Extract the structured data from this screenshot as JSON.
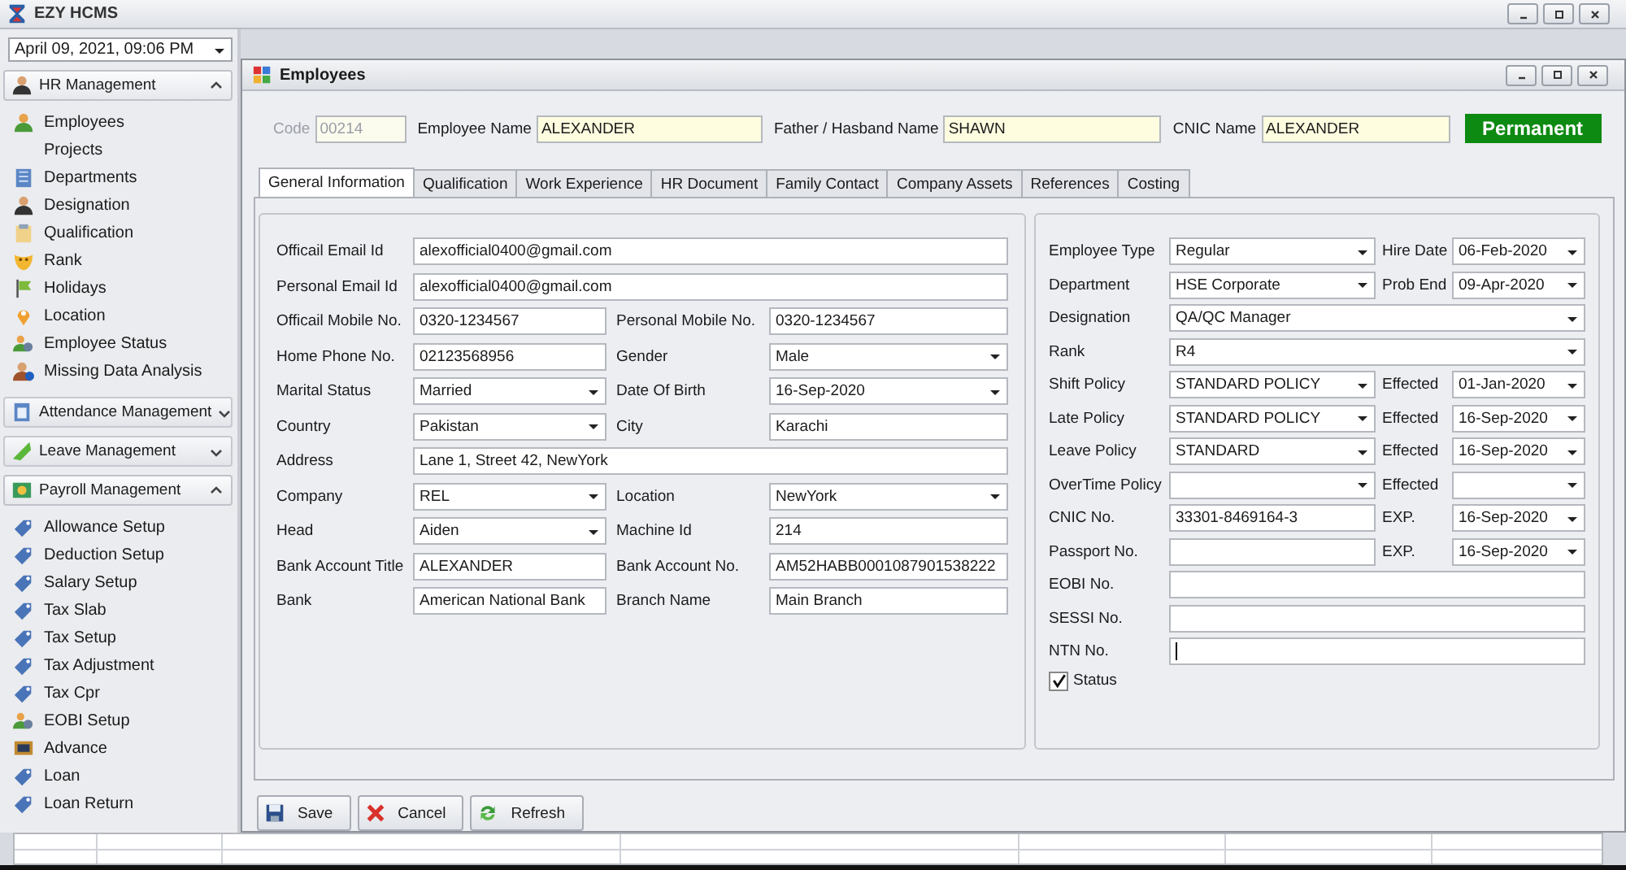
{
  "app": {
    "title": "EZY HCMS"
  },
  "sidebar": {
    "datetime": "April 09, 2021, 09:06 PM",
    "groups": [
      {
        "label": "HR Management",
        "expanded": true,
        "items": [
          {
            "label": "Employees"
          },
          {
            "label": "Projects"
          },
          {
            "label": "Departments"
          },
          {
            "label": "Designation"
          },
          {
            "label": "Qualification"
          },
          {
            "label": "Rank"
          },
          {
            "label": "Holidays"
          },
          {
            "label": "Location"
          },
          {
            "label": "Employee Status"
          },
          {
            "label": "Missing Data Analysis"
          }
        ]
      },
      {
        "label": "Attendance Management",
        "expanded": false
      },
      {
        "label": "Leave Management",
        "expanded": false
      },
      {
        "label": "Payroll Management",
        "expanded": true,
        "items": [
          {
            "label": "Allowance Setup"
          },
          {
            "label": "Deduction Setup"
          },
          {
            "label": "Salary Setup"
          },
          {
            "label": "Tax Slab"
          },
          {
            "label": "Tax Setup"
          },
          {
            "label": "Tax Adjustment"
          },
          {
            "label": "Tax Cpr"
          },
          {
            "label": "EOBI Setup"
          },
          {
            "label": "Advance"
          },
          {
            "label": "Loan"
          },
          {
            "label": "Loan Return"
          }
        ]
      }
    ]
  },
  "window": {
    "title": "Employees",
    "header": [
      {
        "label": "Code",
        "value": "00214",
        "disabled": true
      },
      {
        "label": "Employee Name",
        "value": "ALEXANDER",
        "disabled": false
      },
      {
        "label": "Father / Hasband  Name",
        "value": "SHAWN",
        "disabled": false
      },
      {
        "label": "CNIC Name",
        "value": "ALEXANDER",
        "disabled": false
      }
    ],
    "badge": "Permanent"
  },
  "tabs": [
    {
      "label": "General Information",
      "selected": true
    },
    {
      "label": "Qualification",
      "selected": false
    },
    {
      "label": "Work Experience",
      "selected": false
    },
    {
      "label": "HR Document",
      "selected": false
    },
    {
      "label": "Family Contact",
      "selected": false
    },
    {
      "label": "Company Assets",
      "selected": false
    },
    {
      "label": "References",
      "selected": false
    },
    {
      "label": "Costing",
      "selected": false
    }
  ],
  "left_form": [
    [
      {
        "label": "Officail Email Id",
        "value": "alexofficial0400@gmail.com",
        "kind": "text"
      }
    ],
    [
      {
        "label": "Personal Email Id",
        "value": "alexofficial0400@gmail.com",
        "kind": "text"
      }
    ],
    [
      {
        "label": "Officail Mobile No.",
        "value": "0320-1234567",
        "kind": "text"
      },
      {
        "label": "Personal Mobile No.",
        "value": "0320-1234567",
        "kind": "text"
      }
    ],
    [
      {
        "label": "Home Phone No.",
        "value": "02123568956",
        "kind": "text"
      },
      {
        "label": "Gender",
        "value": "Male",
        "kind": "combo"
      }
    ],
    [
      {
        "label": "Marital Status",
        "value": "Married",
        "kind": "combo"
      },
      {
        "label": "Date Of Birth",
        "value": "16-Sep-2020",
        "kind": "combo"
      }
    ],
    [
      {
        "label": "Country",
        "value": "Pakistan",
        "kind": "combo"
      },
      {
        "label": "City",
        "value": "Karachi",
        "kind": "text"
      }
    ],
    [
      {
        "label": "Address",
        "value": "Lane 1, Street 42, NewYork",
        "kind": "text"
      }
    ],
    [
      {
        "label": "Company",
        "value": "REL",
        "kind": "combo"
      },
      {
        "label": "Location",
        "value": "NewYork",
        "kind": "combo"
      }
    ],
    [
      {
        "label": "Head",
        "value": "Aiden",
        "kind": "combo"
      },
      {
        "label": "Machine Id",
        "value": "214",
        "kind": "text"
      }
    ],
    [
      {
        "label": "Bank Account Title",
        "value": "ALEXANDER",
        "kind": "text"
      },
      {
        "label": "Bank Account No.",
        "value": "AM52HABB0001087901538222",
        "kind": "text"
      }
    ],
    [
      {
        "label": "Bank",
        "value": "American National Bank",
        "kind": "text"
      },
      {
        "label": "Branch Name",
        "value": "Main Branch",
        "kind": "text"
      }
    ]
  ],
  "right_form": [
    [
      {
        "label": "Employee Type",
        "value": "Regular",
        "kind": "combo"
      },
      {
        "label": "Hire Date",
        "value": "06-Feb-2020",
        "kind": "combo"
      }
    ],
    [
      {
        "label": "Department",
        "value": "HSE Corporate",
        "kind": "combo"
      },
      {
        "label": "Prob End",
        "value": "09-Apr-2020",
        "kind": "combo"
      }
    ],
    [
      {
        "label": "Designation",
        "value": "QA/QC Manager",
        "kind": "combo"
      }
    ],
    [
      {
        "label": "Rank",
        "value": "R4",
        "kind": "combo"
      }
    ],
    [
      {
        "label": "Shift Policy",
        "value": "STANDARD POLICY",
        "kind": "combo"
      },
      {
        "label": "Effected",
        "value": "01-Jan-2020",
        "kind": "combo"
      }
    ],
    [
      {
        "label": "Late Policy",
        "value": "STANDARD POLICY",
        "kind": "combo"
      },
      {
        "label": "Effected",
        "value": "16-Sep-2020",
        "kind": "combo"
      }
    ],
    [
      {
        "label": "Leave Policy",
        "value": "STANDARD",
        "kind": "combo"
      },
      {
        "label": "Effected",
        "value": "16-Sep-2020",
        "kind": "combo"
      }
    ],
    [
      {
        "label": "OverTime Policy",
        "kind": "combo"
      },
      {
        "label": "Effected",
        "kind": "combo"
      }
    ],
    [
      {
        "label": "CNIC No.",
        "value": "33301-8469164-3",
        "kind": "text"
      },
      {
        "label": "EXP.",
        "value": "16-Sep-2020",
        "kind": "combo"
      }
    ],
    [
      {
        "label": "Passport No.",
        "kind": "text"
      },
      {
        "label": "EXP.",
        "value": "16-Sep-2020",
        "kind": "combo"
      }
    ],
    [
      {
        "label": "EOBI No.",
        "kind": "text"
      }
    ],
    [
      {
        "label": "SESSI No.",
        "kind": "text"
      }
    ],
    [
      {
        "label": "NTN No.",
        "kind": "text",
        "focused": true
      }
    ]
  ],
  "status_checkbox": {
    "label": "Status",
    "checked": true
  },
  "buttons": [
    {
      "label": "Save"
    },
    {
      "label": "Cancel"
    },
    {
      "label": "Refresh"
    }
  ]
}
